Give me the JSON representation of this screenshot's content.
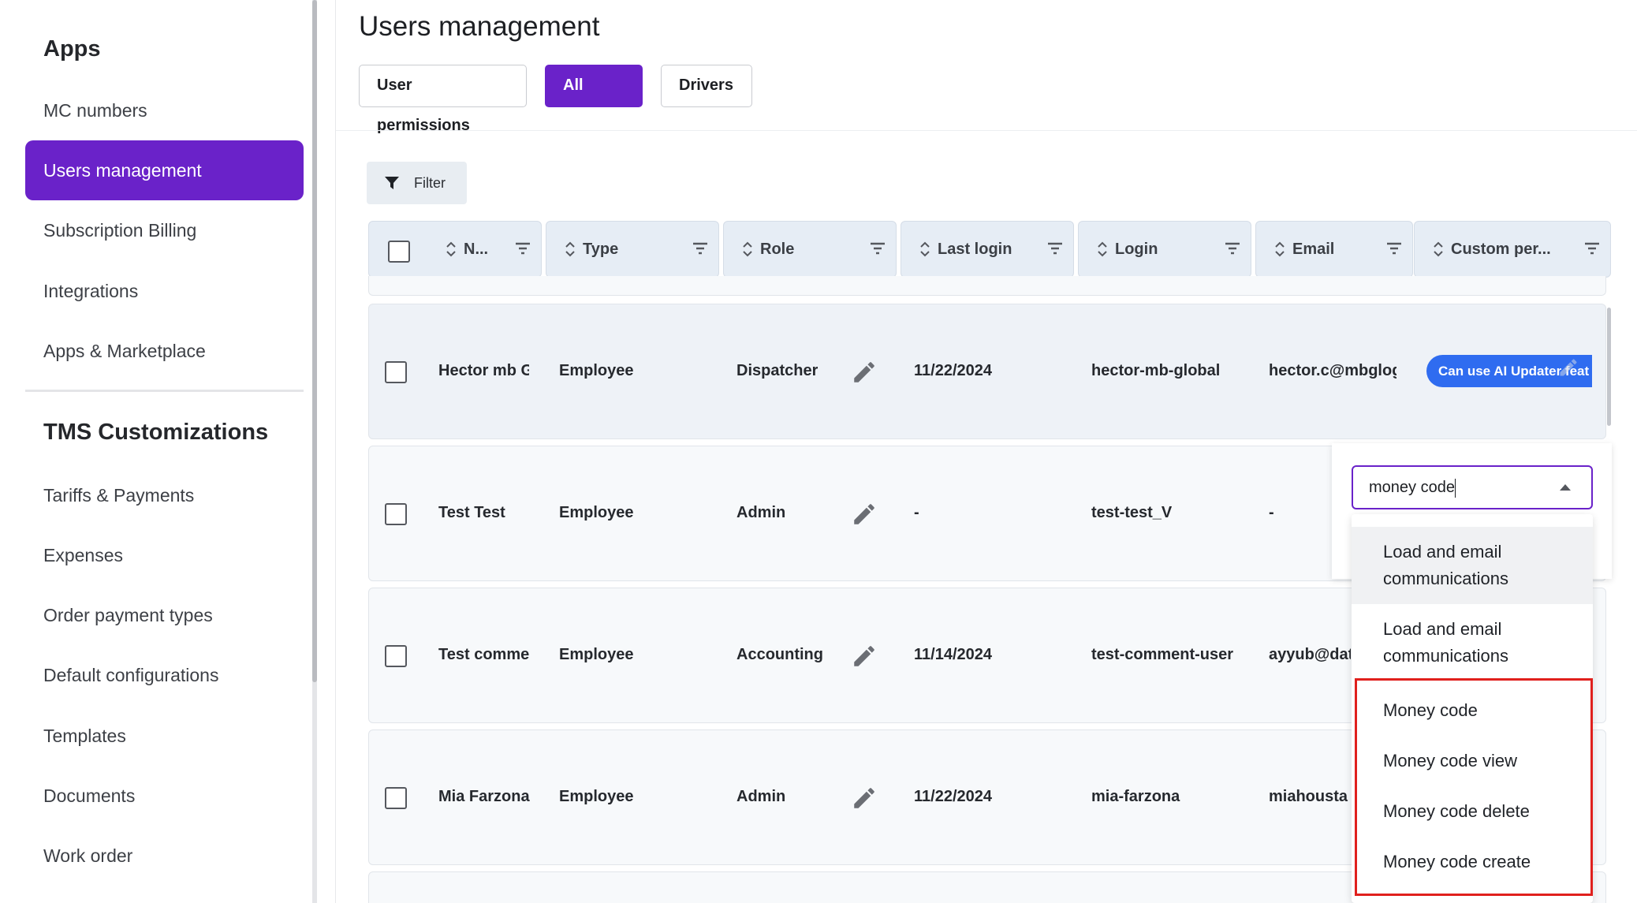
{
  "sidebar": {
    "apps_heading": "Apps",
    "apps_items": [
      {
        "label": "MC numbers"
      },
      {
        "label": "Users management"
      },
      {
        "label": "Subscription Billing"
      },
      {
        "label": "Integrations"
      },
      {
        "label": "Apps & Marketplace"
      }
    ],
    "tms_heading": "TMS Customizations",
    "tms_items": [
      {
        "label": "Tariffs & Payments"
      },
      {
        "label": "Expenses"
      },
      {
        "label": "Order payment types"
      },
      {
        "label": "Default configurations"
      },
      {
        "label": "Templates"
      },
      {
        "label": "Documents"
      },
      {
        "label": "Work order"
      }
    ],
    "active_color": "#6a22c9"
  },
  "header": {
    "title": "Users management",
    "tabs": [
      {
        "label": "User permissions"
      },
      {
        "label": "All users"
      },
      {
        "label": "Drivers"
      }
    ]
  },
  "toolbar": {
    "filter_label": "Filter"
  },
  "table": {
    "columns": [
      {
        "label": "N..."
      },
      {
        "label": "Type"
      },
      {
        "label": "Role"
      },
      {
        "label": "Last login"
      },
      {
        "label": "Login"
      },
      {
        "label": "Email"
      },
      {
        "label": "Custom per..."
      }
    ],
    "rows": [
      {
        "name": "Hector mb G",
        "type": "Employee",
        "role": "Dispatcher",
        "last_login": "11/22/2024",
        "login": "hector-mb-global",
        "email": "hector.c@mbglog",
        "custom": "Can use AI Updater feat"
      },
      {
        "name": "Test Test",
        "type": "Employee",
        "role": "Admin",
        "last_login": "-",
        "login": "test-test_V",
        "email": "-"
      },
      {
        "name": "Test comme",
        "type": "Employee",
        "role": "Accounting",
        "last_login": "11/14/2024",
        "login": "test-comment-user",
        "email": "ayyub@dat"
      },
      {
        "name": "Mia Farzona",
        "type": "Employee",
        "role": "Admin",
        "last_login": "11/22/2024",
        "login": "mia-farzona",
        "email": "miahousta"
      }
    ]
  },
  "dropdown": {
    "input_value": "money code",
    "options": [
      {
        "line1": "Load and email",
        "line2": "communications"
      },
      {
        "line1": "Load and email",
        "line2": "communications"
      },
      {
        "line1": "Money code"
      },
      {
        "line1": "Money code view"
      },
      {
        "line1": "Money code delete"
      },
      {
        "line1": "Money code create"
      }
    ],
    "highlight_color": "#e0201d"
  }
}
